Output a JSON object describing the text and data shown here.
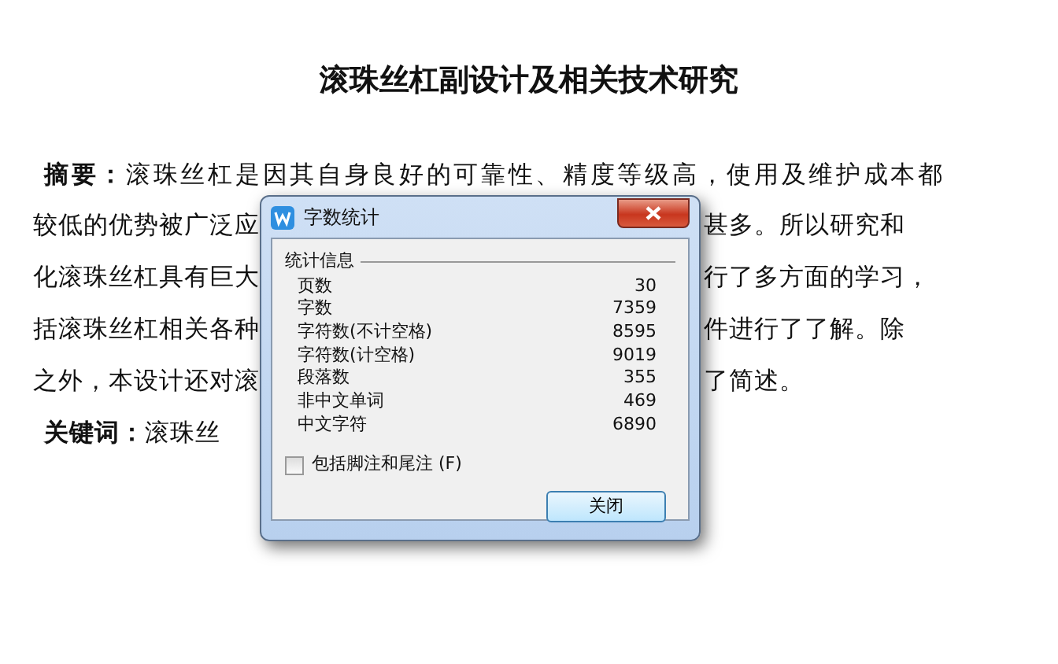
{
  "document": {
    "title": "滚珠丝杠副设计及相关技术研究",
    "lines": [
      {
        "text": "**摘要：**滚珠丝杠是因其自身良好的可靠性、精度等级高，使用及维护成本都"
      },
      {
        "left": "较低的优势被广泛应",
        "right": "甚多。所以研究和"
      },
      {
        "left": "化滚珠丝杠具有巨大",
        "right": "行了多方面的学习，"
      },
      {
        "left": "括滚珠丝杠相关各种",
        "right": "件进行了了解。除"
      },
      {
        "left": "之外，本设计还对滚",
        "right": "了简述。"
      },
      {
        "left": "**关键词：**滚珠丝"
      }
    ]
  },
  "dialog": {
    "title": "字数统计",
    "group_label": "统计信息",
    "stats": [
      {
        "label": "页数",
        "value": "30"
      },
      {
        "label": "字数",
        "value": "7359"
      },
      {
        "label": "字符数(不计空格)",
        "value": "8595"
      },
      {
        "label": "字符数(计空格)",
        "value": "9019"
      },
      {
        "label": "段落数",
        "value": "355"
      },
      {
        "label": "非中文单词",
        "value": "469"
      },
      {
        "label": "中文字符",
        "value": "6890"
      }
    ],
    "checkbox": {
      "label": "包括脚注和尾注",
      "accelerator": "(F)",
      "checked": false
    },
    "button": "关闭"
  }
}
